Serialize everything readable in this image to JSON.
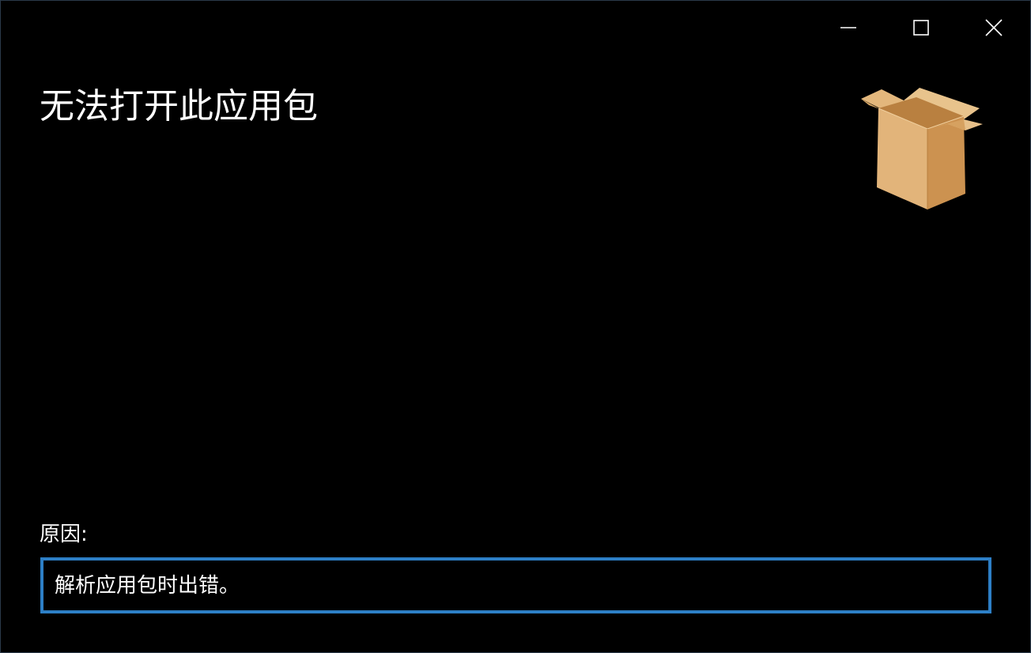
{
  "window": {
    "title": "无法打开此应用包",
    "caption_buttons": {
      "minimize_icon": "minimize-icon",
      "maximize_icon": "maximize-icon",
      "close_icon": "close-icon"
    }
  },
  "icon": {
    "name": "package-box-icon"
  },
  "reason": {
    "label": "原因:",
    "text": "解析应用包时出错。"
  },
  "colors": {
    "background": "#000000",
    "text": "#ffffff",
    "accent_border": "#2d7fc6",
    "box_light": "#e6bd86",
    "box_mid": "#d9a868",
    "box_dark": "#c68d4c"
  }
}
